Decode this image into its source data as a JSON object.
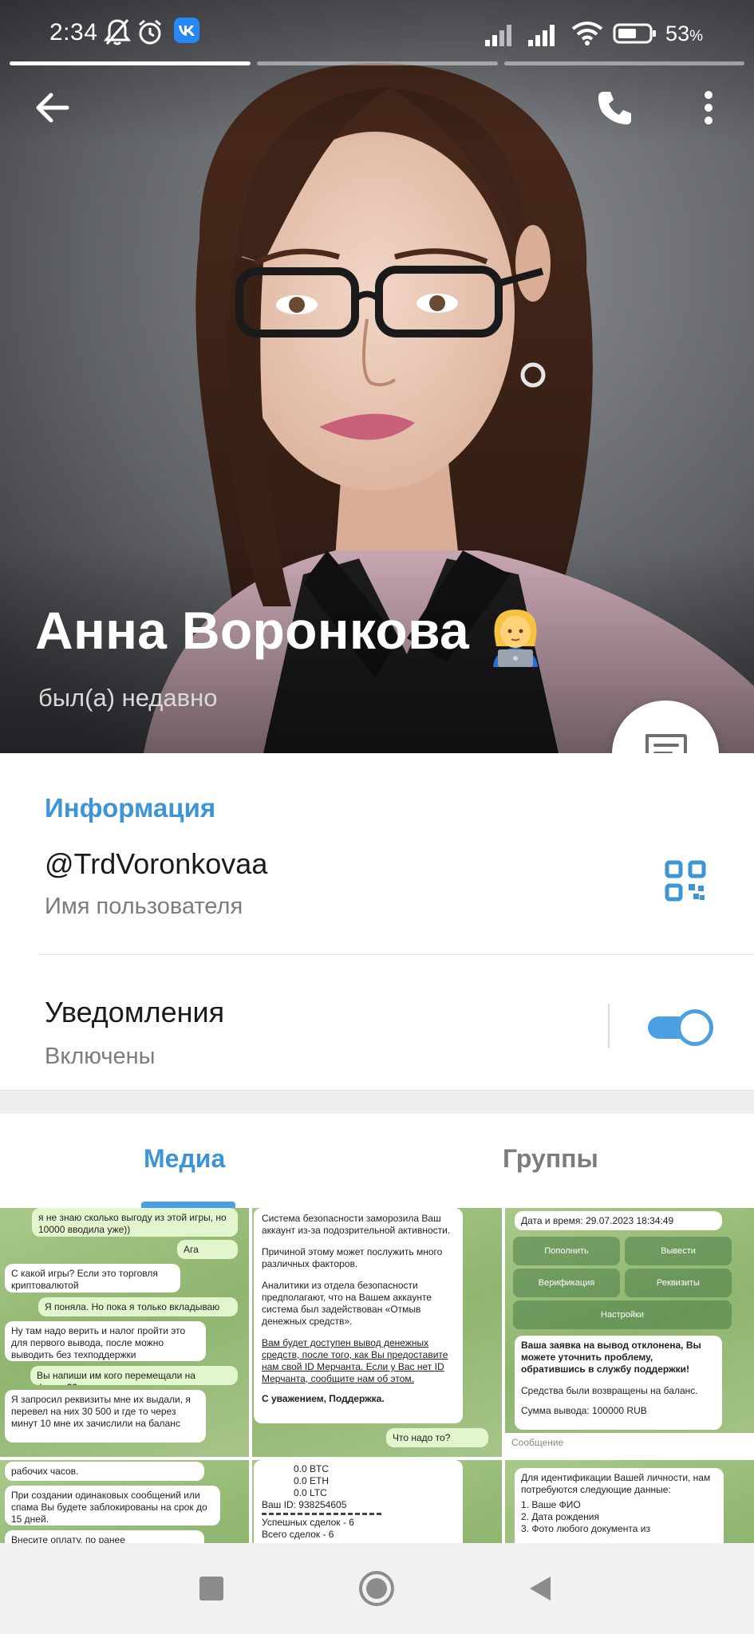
{
  "status_bar": {
    "time": "2:34",
    "battery_percent": "53",
    "battery_unit": "%",
    "icons": [
      "mute-icon",
      "alarm-icon",
      "vk-icon",
      "signal-icon",
      "signal-icon",
      "wifi-icon",
      "battery-icon"
    ]
  },
  "profile": {
    "name": "Анна Воронкова",
    "emoji": "woman-technologist-emoji",
    "last_seen": "был(а) недавно"
  },
  "info": {
    "section_title": "Информация",
    "username": "@TrdVoronkovaa",
    "username_caption": "Имя пользователя",
    "notifications_label": "Уведомления",
    "notifications_status": "Включены",
    "notifications_enabled": true
  },
  "tabs": [
    {
      "label": "Медиа",
      "active": true
    },
    {
      "label": "Группы",
      "active": false
    }
  ],
  "media": [
    {
      "bubbles": [
        {
          "text": "я не знаю сколько выгоду из этой игры, но 10000 вводила уже))",
          "out": true
        },
        {
          "text": "Ага",
          "out": true
        },
        {
          "text": "С какой игры? Если это торговля криптовалютой",
          "out": false
        },
        {
          "text": "Я поняла. Но пока я только вкладываю",
          "out": true
        },
        {
          "text": "Ну там надо верить и налог пройти это для первого вывода, после можно выводить без техподдержки",
          "out": false
        },
        {
          "text": "Вы напиши им кого перемещали на фирму??",
          "out": true
        },
        {
          "text": "Я запросил реквизиты мне их выдали, я перевел на них 30 500 и где то через минут 10 мне их зачислили на баланс",
          "out": false
        }
      ]
    },
    {
      "bubbles": [
        {
          "text": "Система безопасности заморозила Ваш аккаунт из-за подозрительной активности.",
          "out": false
        },
        {
          "text": "Причиной этому может послужить много различных факторов.",
          "out": false
        },
        {
          "text": "Аналитики из отдела безопасности предполагают, что на Вашем аккаунте система был задействован «Отмыв денежных средств».",
          "out": false
        },
        {
          "text": "Вам будет доступен вывод денежных средств, после того, как Вы предоставите нам свой ID Мерчанта. Если у Вас нет ID Мерчанта, сообщите нам об этом.",
          "out": false
        },
        {
          "text": "С уважением, Поддержка.",
          "out": false
        },
        {
          "text": "Что надо то?",
          "out": true
        }
      ]
    },
    {
      "header": "Дата и время: 29.07.2023 18:34:49",
      "keyboard": [
        "Пополнить",
        "Вывести",
        "Верификация",
        "Реквизиты",
        "Настройки"
      ],
      "bubbles": [
        {
          "text": "Ваша заявка на вывод отклонена, Вы можете уточнить проблему, обратившись в службу поддержки!",
          "out": false
        },
        {
          "text": "Средства были возвращены на баланс.",
          "out": false
        },
        {
          "text": "Сумма вывода: 100000 RUB",
          "out": false
        }
      ],
      "input_placeholder": "Сообщение"
    },
    {
      "bubbles": [
        {
          "text": "рабочих часов.",
          "out": false
        },
        {
          "text": "При создании одинаковых сообщений или спама Вы будете заблокированы на срок до 15 дней.",
          "out": false
        },
        {
          "text": "Внесите оплату, по ранее",
          "out": false
        }
      ]
    },
    {
      "bubbles": [
        {
          "text": "0.0 BTC",
          "out": false
        },
        {
          "text": "0.0 ETH",
          "out": false
        },
        {
          "text": "0.0 LTC",
          "out": false
        },
        {
          "text": "Ваш ID: 938254605",
          "out": false
        },
        {
          "text": "Успешных сделок - 6",
          "out": false
        },
        {
          "text": "Всего сделок - 6",
          "out": false
        }
      ]
    },
    {
      "bubbles": [
        {
          "text": "Для идентификации Вашей личности, нам потребуются следующие данные:",
          "out": false
        },
        {
          "text": "1. Ваше ФИО",
          "out": false
        },
        {
          "text": "2. Дата рождения",
          "out": false
        },
        {
          "text": "3. Фото любого документа из",
          "out": false
        }
      ]
    }
  ],
  "colors": {
    "accent": "#3d95d6",
    "toggle": "#4aa0e2",
    "secondary_text": "#7c7c7c"
  }
}
